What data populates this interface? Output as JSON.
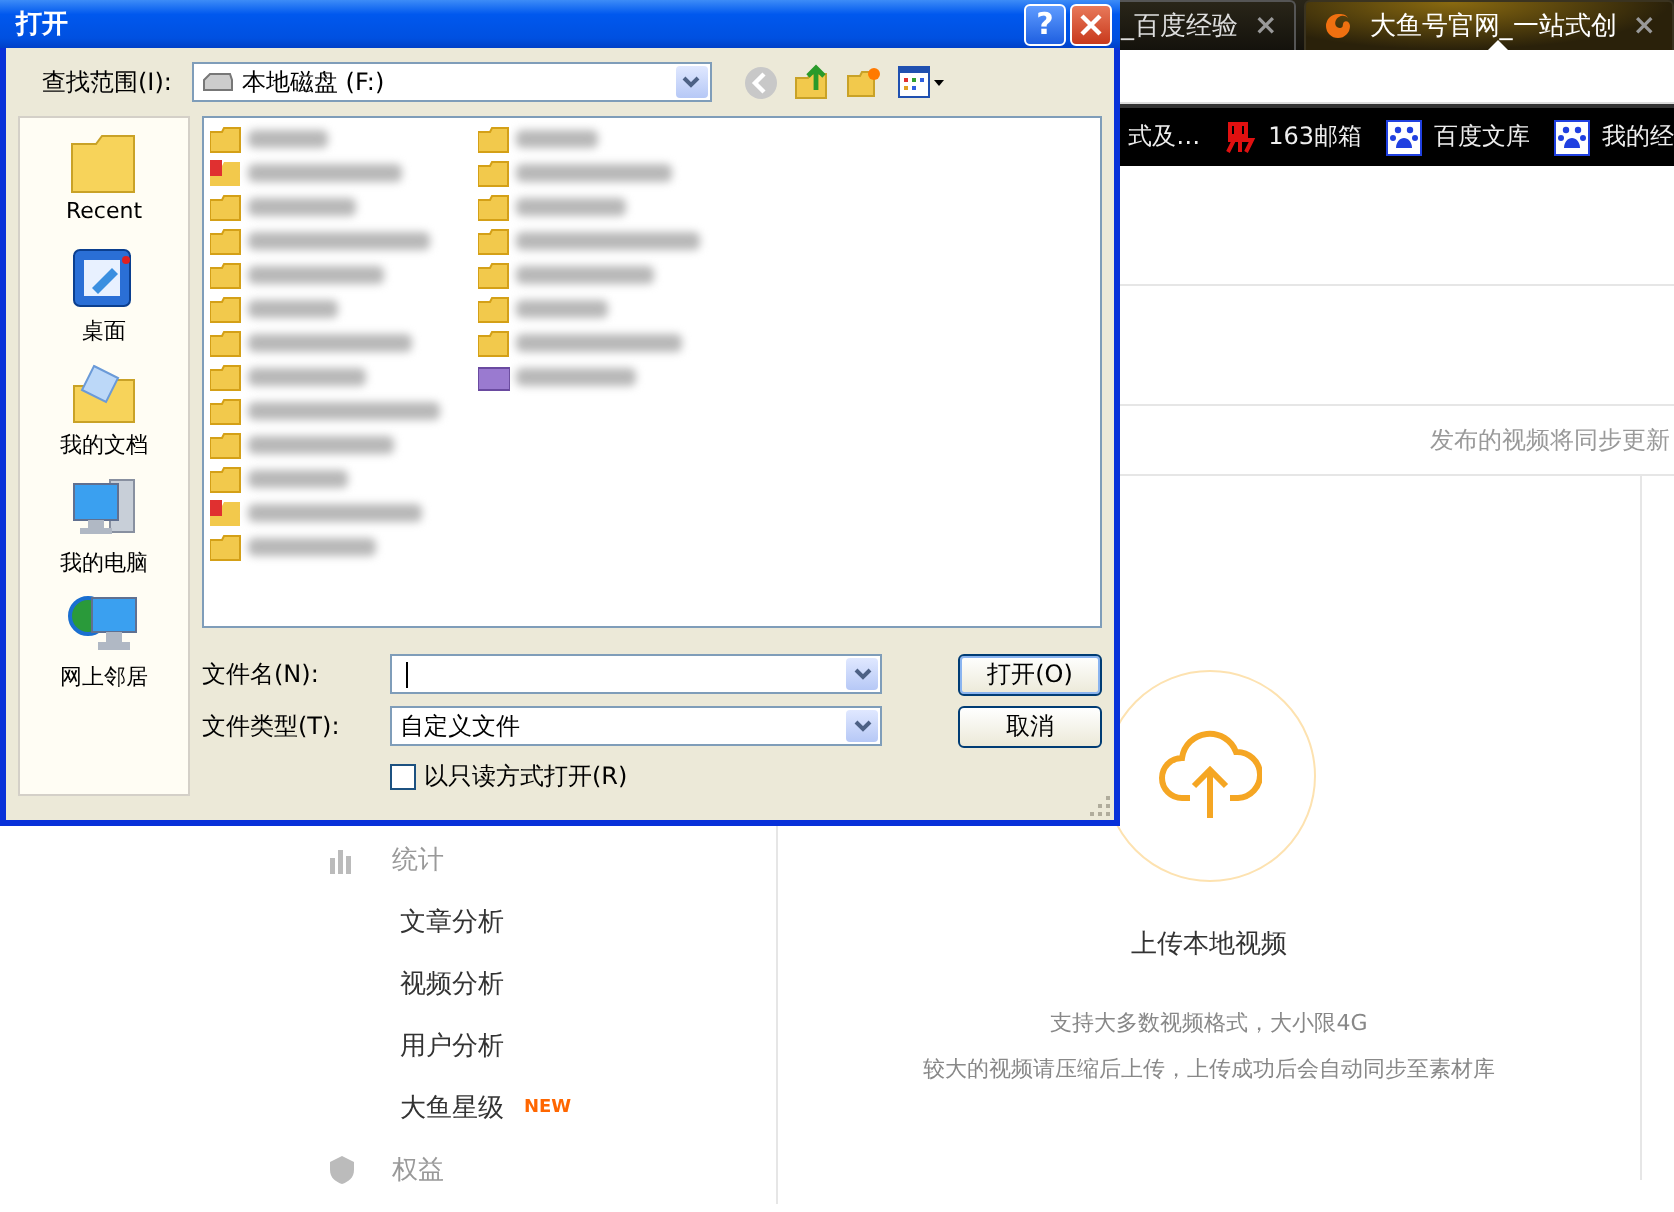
{
  "browser": {
    "tabs": [
      {
        "title": "_百度经验",
        "selected": false,
        "close": "×"
      },
      {
        "title": "大鱼号官网_一站式创",
        "selected": true,
        "close": "×"
      }
    ],
    "bookmarks": [
      {
        "label": "式及…",
        "kind": "text"
      },
      {
        "label": "163邮箱",
        "kind": "mail"
      },
      {
        "label": "百度文库",
        "kind": "paw"
      },
      {
        "label": "我的经",
        "kind": "paw"
      }
    ]
  },
  "page": {
    "notice": "发布的视频将同步更新",
    "sidebar": [
      {
        "label": "统计",
        "kind": "section"
      },
      {
        "label": "文章分析",
        "kind": "item"
      },
      {
        "label": "视频分析",
        "kind": "item"
      },
      {
        "label": "用户分析",
        "kind": "item"
      },
      {
        "label": "大鱼星级",
        "kind": "item",
        "badge": "NEW"
      },
      {
        "label": "权益",
        "kind": "section"
      }
    ],
    "upload": {
      "title": "上传本地视频",
      "hints": [
        "支持大多数视频格式，大小限4G",
        "较大的视频请压缩后上传，上传成功后会自动同步至素材库"
      ]
    }
  },
  "dialog": {
    "title": "打开",
    "help": "?",
    "look_in_label": "查找范围(I):",
    "look_in": "本地磁盘 (F:)",
    "places": [
      {
        "label": "Recent",
        "kind": "recent"
      },
      {
        "label": "桌面",
        "kind": "desktop"
      },
      {
        "label": "我的文档",
        "kind": "documents"
      },
      {
        "label": "我的电脑",
        "kind": "computer"
      },
      {
        "label": "网上邻居",
        "kind": "network"
      }
    ],
    "files": [
      {
        "kind": "folder"
      },
      {
        "kind": "picture"
      },
      {
        "kind": "folder"
      },
      {
        "kind": "folder"
      },
      {
        "kind": "folder"
      },
      {
        "kind": "folder"
      },
      {
        "kind": "folder"
      },
      {
        "kind": "folder"
      },
      {
        "kind": "folder"
      },
      {
        "kind": "folder"
      },
      {
        "kind": "folder"
      },
      {
        "kind": "picture"
      },
      {
        "kind": "folder"
      },
      {
        "kind": "folder"
      },
      {
        "kind": "folder"
      },
      {
        "kind": "folder"
      },
      {
        "kind": "folder"
      },
      {
        "kind": "folder"
      },
      {
        "kind": "folder"
      },
      {
        "kind": "folder"
      },
      {
        "kind": "media"
      }
    ],
    "file_name_label": "文件名(N):",
    "file_type_label": "文件类型(T):",
    "file_type": "自定义文件",
    "readonly": {
      "label": "以只读方式打开(R)",
      "checked": false
    },
    "buttons": [
      {
        "label": "打开(O)",
        "default": true
      },
      {
        "label": "取消",
        "default": false
      }
    ]
  }
}
